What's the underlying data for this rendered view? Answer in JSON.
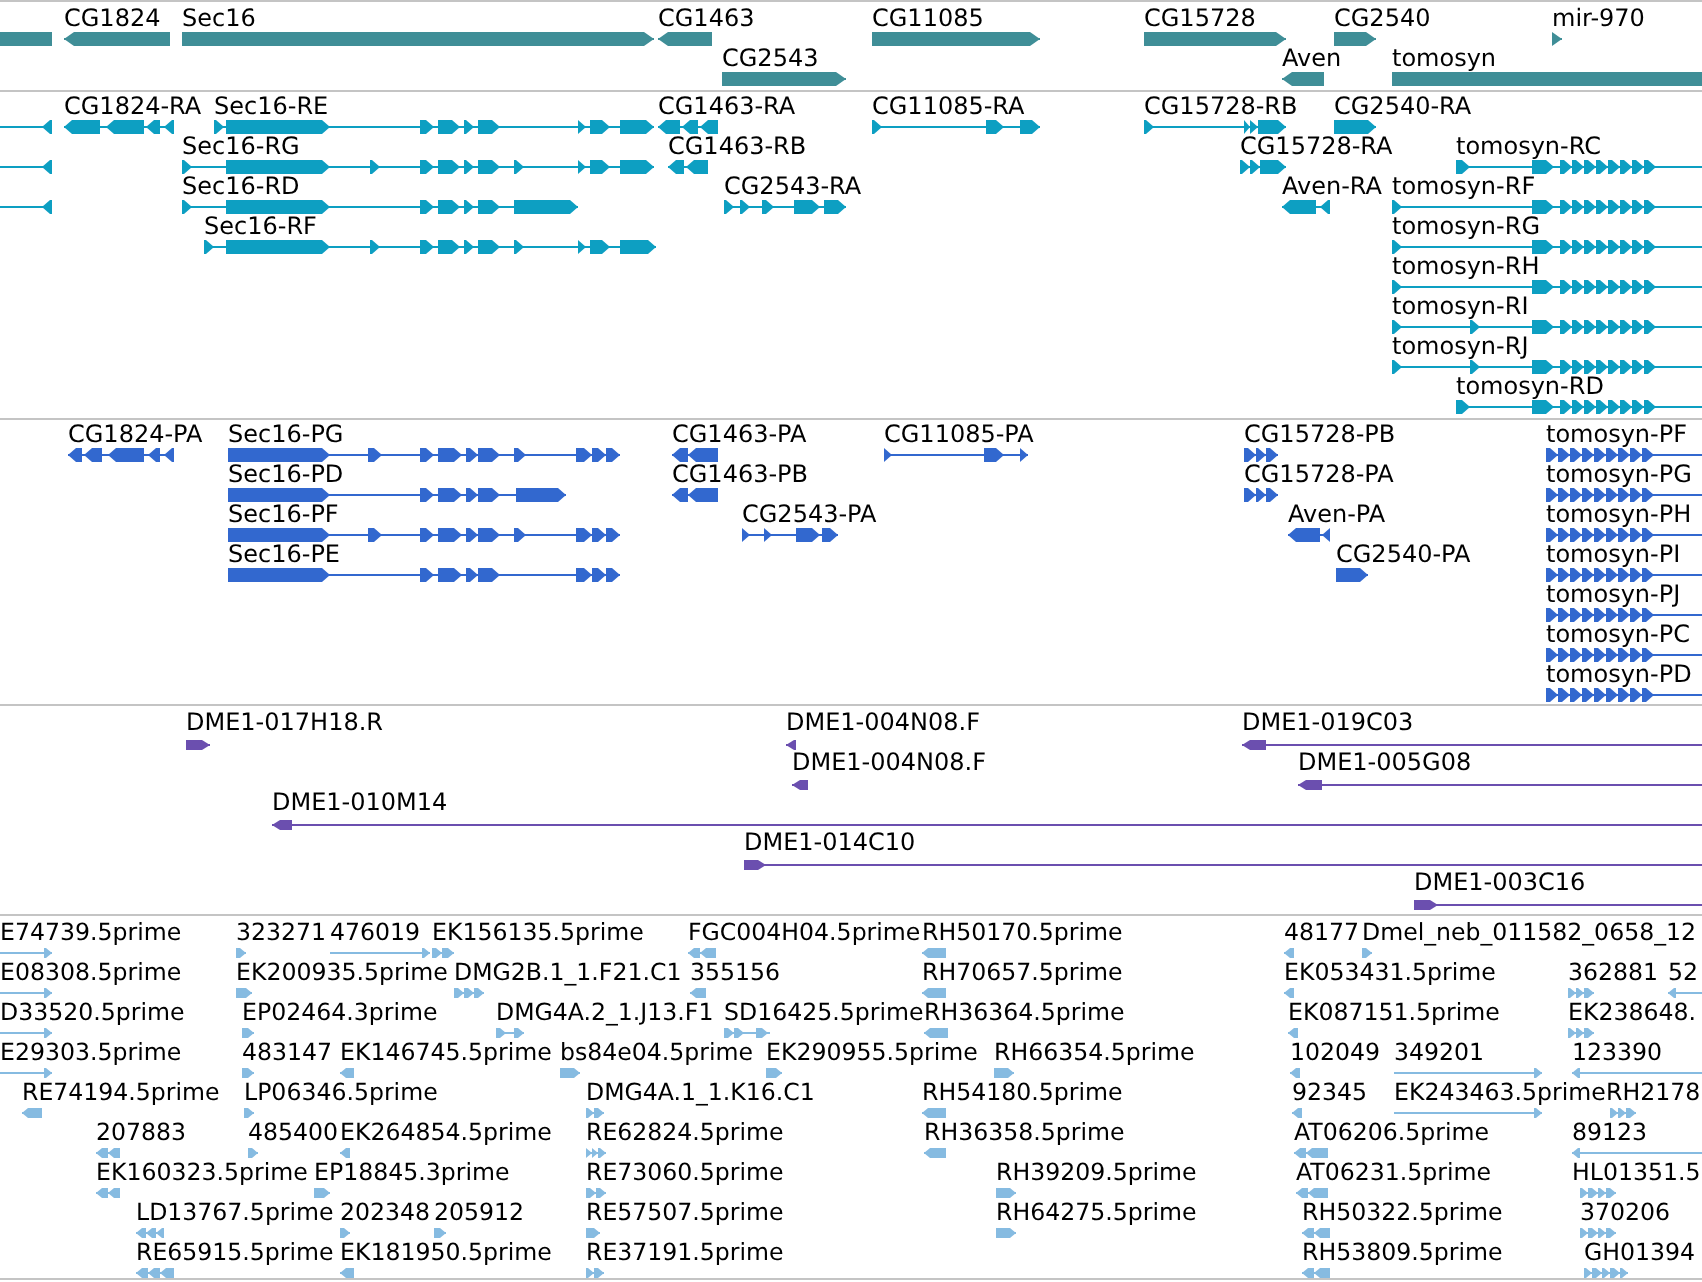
{
  "tracks": [
    {
      "kind": "gene",
      "features": [
        {
          "reverse": true
        },
        {
          "label": "CG1824",
          "reverse": true
        },
        {
          "label": "Sec16",
          "reverse": false
        },
        {
          "label": "CG1463",
          "reverse": true
        },
        {
          "label": "CG11085",
          "reverse": false
        },
        {
          "label": "CG15728",
          "reverse": false
        },
        {
          "label": "CG2540",
          "reverse": false
        },
        {
          "label": "mir-970",
          "reverse": false
        },
        {
          "label": "CG2543",
          "reverse": false
        },
        {
          "label": "Aven",
          "reverse": true
        },
        {
          "label": "tomosyn",
          "reverse": false
        }
      ]
    },
    {
      "kind": "transcript",
      "features": [
        {
          "reverse": true
        },
        {
          "label": "CG1824-RA",
          "reverse": true
        },
        {
          "label": "Sec16-RE",
          "reverse": false
        },
        {
          "label": "CG1463-RA",
          "reverse": true
        },
        {
          "label": "CG11085-RA",
          "reverse": false
        },
        {
          "label": "CG15728-RB",
          "reverse": false
        },
        {
          "label": "CG2540-RA",
          "reverse": false
        },
        {
          "reverse": true
        },
        {
          "label": "Sec16-RG",
          "reverse": false
        },
        {
          "label": "CG1463-RB",
          "reverse": true
        },
        {
          "label": "CG15728-RA",
          "reverse": false
        },
        {
          "label": "tomosyn-RC",
          "reverse": false
        },
        {
          "reverse": true
        },
        {
          "label": "Sec16-RD",
          "reverse": false
        },
        {
          "label": "CG2543-RA",
          "reverse": false
        },
        {
          "label": "Aven-RA",
          "reverse": true
        },
        {
          "label": "tomosyn-RF",
          "reverse": false
        },
        {
          "label": "Sec16-RF",
          "reverse": false
        },
        {
          "label": "tomosyn-RG",
          "reverse": false
        },
        {
          "label": "tomosyn-RH",
          "reverse": false
        },
        {
          "label": "tomosyn-RI",
          "reverse": false
        },
        {
          "label": "tomosyn-RJ",
          "reverse": false
        },
        {
          "label": "tomosyn-RD",
          "reverse": false
        }
      ]
    },
    {
      "kind": "protein",
      "features": [
        {
          "label": "CG1824-PA",
          "reverse": true
        },
        {
          "label": "Sec16-PG",
          "reverse": false
        },
        {
          "label": "CG1463-PA",
          "reverse": true
        },
        {
          "label": "CG11085-PA",
          "reverse": false
        },
        {
          "label": "CG15728-PB",
          "reverse": false
        },
        {
          "label": "tomosyn-PF",
          "reverse": false
        },
        {
          "label": "Sec16-PD",
          "reverse": false
        },
        {
          "label": "CG1463-PB",
          "reverse": true
        },
        {
          "label": "CG15728-PA",
          "reverse": false
        },
        {
          "label": "tomosyn-PG",
          "reverse": false
        },
        {
          "label": "Sec16-PF",
          "reverse": false
        },
        {
          "label": "CG2543-PA",
          "reverse": false
        },
        {
          "label": "Aven-PA",
          "reverse": true
        },
        {
          "label": "tomosyn-PH",
          "reverse": false
        },
        {
          "label": "Sec16-PE",
          "reverse": false
        },
        {
          "label": "CG2540-PA",
          "reverse": false
        },
        {
          "label": "tomosyn-PI",
          "reverse": false
        },
        {
          "label": "tomosyn-PJ",
          "reverse": false
        },
        {
          "label": "tomosyn-PC",
          "reverse": false
        },
        {
          "label": "tomosyn-PD",
          "reverse": false
        }
      ]
    },
    {
      "kind": "clone",
      "features": [
        {
          "label": "DME1-017H18.R",
          "reverse": false
        },
        {
          "label": "DME1-004N08.F",
          "reverse": true
        },
        {
          "label": "DME1-019C03",
          "reverse": true
        },
        {
          "label": "DME1-004N08.F",
          "reverse": true
        },
        {
          "label": "DME1-005G08",
          "reverse": true
        },
        {
          "label": "DME1-010M14",
          "reverse": true
        },
        {
          "label": "DME1-014C10",
          "reverse": false
        },
        {
          "label": "DME1-003C16",
          "reverse": false
        }
      ]
    },
    {
      "kind": "est",
      "features": [
        {
          "label": "E74739.5prime",
          "reverse": false
        },
        {
          "label": "323271",
          "reverse": false
        },
        {
          "label": "476019",
          "reverse": false
        },
        {
          "label": "EK156135.5prime",
          "reverse": false
        },
        {
          "label": "FGC004H04.5prime",
          "reverse": true
        },
        {
          "label": "RH50170.5prime",
          "reverse": true
        },
        {
          "label": "48177",
          "reverse": true
        },
        {
          "label": "Dmel_neb_011582_0658_12",
          "reverse": false
        },
        {
          "label": "E08308.5prime",
          "reverse": false
        },
        {
          "label": "EK200935.5prime",
          "reverse": false
        },
        {
          "label": "DMG2B.1_1.F21.C1",
          "reverse": false
        },
        {
          "label": "355156",
          "reverse": true
        },
        {
          "label": "RH70657.5prime",
          "reverse": true
        },
        {
          "label": "EK053431.5prime",
          "reverse": true
        },
        {
          "label": "362881",
          "reverse": false
        },
        {
          "label": "52",
          "reverse": true
        },
        {
          "label": "D33520.5prime",
          "reverse": false
        },
        {
          "label": "EP02464.3prime",
          "reverse": false
        },
        {
          "label": "DMG4A.2_1.J13.F1",
          "reverse": false
        },
        {
          "label": "SD16425.5prime",
          "reverse": false
        },
        {
          "label": "RH36364.5prime",
          "reverse": true
        },
        {
          "label": "EK087151.5prime",
          "reverse": true
        },
        {
          "label": "EK238648.",
          "reverse": false
        },
        {
          "label": "E29303.5prime",
          "reverse": false
        },
        {
          "label": "483147",
          "reverse": false
        },
        {
          "label": "EK146745.5prime",
          "reverse": true
        },
        {
          "label": "bs84e04.5prime",
          "reverse": false
        },
        {
          "label": "EK290955.5prime",
          "reverse": false
        },
        {
          "label": "RH66354.5prime",
          "reverse": false
        },
        {
          "label": "102049",
          "reverse": true
        },
        {
          "label": "349201",
          "reverse": false
        },
        {
          "label": "123390",
          "reverse": true
        },
        {
          "label": "RE74194.5prime",
          "reverse": true
        },
        {
          "label": "LP06346.5prime",
          "reverse": false
        },
        {
          "label": "DMG4A.1_1.K16.C1",
          "reverse": false
        },
        {
          "label": "RH54180.5prime",
          "reverse": true
        },
        {
          "label": "92345",
          "reverse": true
        },
        {
          "label": "EK243463.5prime",
          "reverse": false
        },
        {
          "label": "RH2178",
          "reverse": false
        },
        {
          "label": "207883",
          "reverse": true
        },
        {
          "label": "485400",
          "reverse": false
        },
        {
          "label": "EK264854.5prime",
          "reverse": true
        },
        {
          "label": "RE62824.5prime",
          "reverse": false
        },
        {
          "label": "RH36358.5prime",
          "reverse": true
        },
        {
          "label": "AT06206.5prime",
          "reverse": true
        },
        {
          "label": "89123",
          "reverse": true
        },
        {
          "label": "EK160323.5prime",
          "reverse": true
        },
        {
          "label": "EP18845.3prime",
          "reverse": false
        },
        {
          "label": "RE73060.5prime",
          "reverse": false
        },
        {
          "label": "RH39209.5prime",
          "reverse": false
        },
        {
          "label": "AT06231.5prime",
          "reverse": true
        },
        {
          "label": "HL01351.5",
          "reverse": false
        },
        {
          "label": "LD13767.5prime",
          "reverse": true
        },
        {
          "label": "202348",
          "reverse": false
        },
        {
          "label": "205912",
          "reverse": false
        },
        {
          "label": "RE57507.5prime",
          "reverse": false
        },
        {
          "label": "RH64275.5prime",
          "reverse": false
        },
        {
          "label": "RH50322.5prime",
          "reverse": true
        },
        {
          "label": "370206",
          "reverse": false
        },
        {
          "label": "RE65915.5prime",
          "reverse": true
        },
        {
          "label": "EK181950.5prime",
          "reverse": true
        },
        {
          "label": "RE37191.5prime",
          "reverse": false
        },
        {
          "label": "RH53809.5prime",
          "reverse": true
        },
        {
          "label": "GH01394",
          "reverse": false
        }
      ]
    }
  ]
}
